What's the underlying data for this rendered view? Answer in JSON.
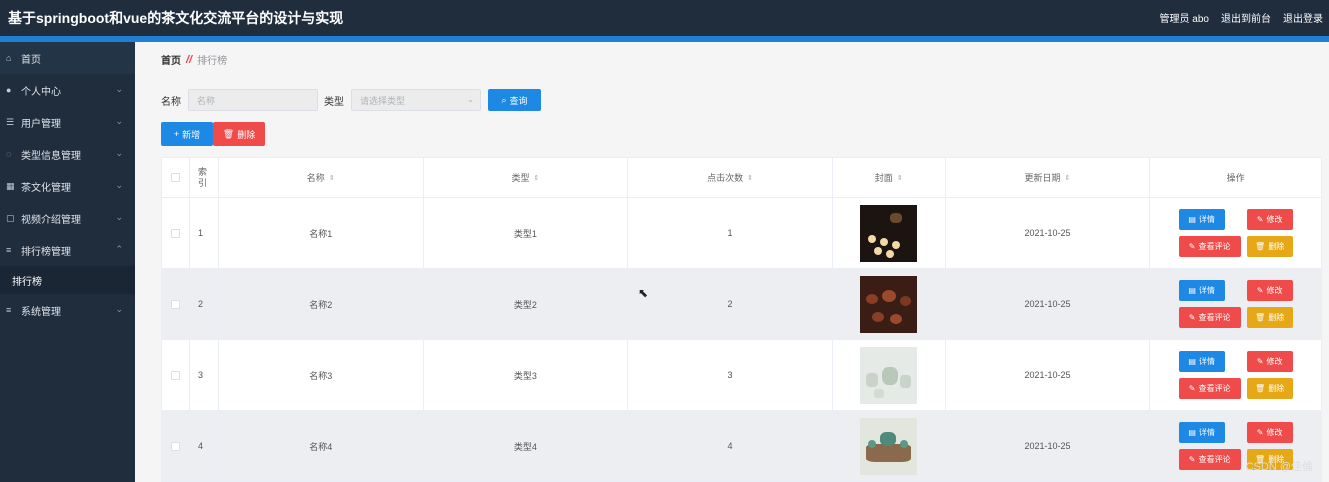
{
  "header": {
    "title": "基于springboot和vue的茶文化交流平台的设计与实现",
    "admin_label": "管理员 abo",
    "back_label": "退出到前台",
    "logout_label": "退出登录"
  },
  "sidebar": {
    "items": [
      {
        "label": "首页",
        "icon": "home-icon",
        "chevron": ""
      },
      {
        "label": "个人中心",
        "icon": "user-icon",
        "chevron": "⌄"
      },
      {
        "label": "用户管理",
        "icon": "list-icon",
        "chevron": "⌄"
      },
      {
        "label": "类型信息管理",
        "icon": "tag-icon",
        "chevron": "⌄"
      },
      {
        "label": "茶文化管理",
        "icon": "grid-icon",
        "chevron": "⌄"
      },
      {
        "label": "视频介绍管理",
        "icon": "video-icon",
        "chevron": "⌄"
      },
      {
        "label": "排行榜管理",
        "icon": "menu-icon",
        "chevron": "⌃"
      },
      {
        "label": "系统管理",
        "icon": "menu-icon",
        "chevron": "⌄"
      }
    ],
    "sub_item": "排行榜"
  },
  "breadcrumb": {
    "home": "首页",
    "current": "排行榜"
  },
  "search": {
    "name_label": "名称",
    "name_placeholder": "名称",
    "type_label": "类型",
    "type_placeholder": "请选择类型",
    "query_button": "查询"
  },
  "actions": {
    "add": "新增",
    "delete": "删除"
  },
  "table": {
    "headers": {
      "index": "索引",
      "name": "名称",
      "type": "类型",
      "clicks": "点击次数",
      "cover": "封面",
      "date": "更新日期",
      "ops": "操作"
    },
    "rows": [
      {
        "index": "1",
        "name": "名称1",
        "type": "类型1",
        "clicks": "1",
        "date": "2021-10-25"
      },
      {
        "index": "2",
        "name": "名称2",
        "type": "类型2",
        "clicks": "2",
        "date": "2021-10-25"
      },
      {
        "index": "3",
        "name": "名称3",
        "type": "类型3",
        "clicks": "3",
        "date": "2021-10-25"
      },
      {
        "index": "4",
        "name": "名称4",
        "type": "类型4",
        "clicks": "4",
        "date": "2021-10-25"
      }
    ],
    "ops": {
      "detail": "详情",
      "edit": "修改",
      "review": "查看评论",
      "delete": "删除"
    }
  },
  "watermark": "CSDN @佳倫",
  "colors": {
    "sidebar": "#1f2d3d",
    "accent": "#1e88e5",
    "danger": "#ef4b4b",
    "warning": "#e6a817"
  }
}
